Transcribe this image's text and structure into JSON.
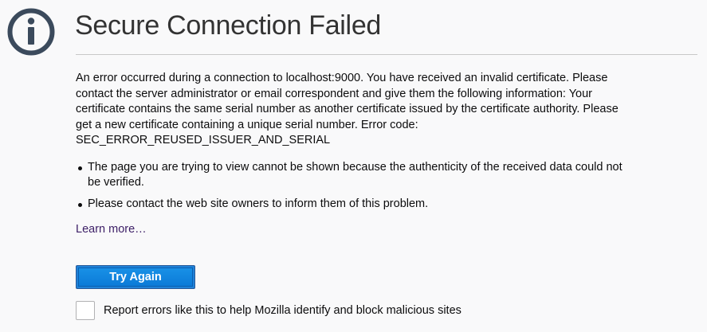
{
  "error": {
    "title": "Secure Connection Failed",
    "description": "An error occurred during a connection to localhost:9000. You have received an invalid certificate. Please\ncontact the server administrator or email correspondent and give them the following information: Your\ncertificate contains the same serial number as another certificate issued by the certificate authority. Please\nget a new certificate containing a unique serial number. Error code:\nSEC_ERROR_REUSED_ISSUER_AND_SERIAL",
    "bullets": [
      "The page you are trying to view cannot be shown because the authenticity of the received data could not\nbe verified.",
      "Please contact the web site owners to inform them of this problem."
    ],
    "learn_more": "Learn more…",
    "try_again_label": "Try Again",
    "report_label": "Report errors like this to help Mozilla identify and block malicious sites",
    "report_checked": false
  },
  "icons": {
    "main": "info-icon"
  },
  "colors": {
    "background": "#f9f9fa",
    "icon": "#3b4a5c",
    "title": "#333333",
    "link": "#3c1e66",
    "button": "#0a78d6"
  }
}
